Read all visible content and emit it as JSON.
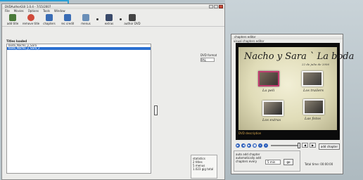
{
  "main_window": {
    "title": "DVDAuthorGUI 1.0.4 - 7/15/2007",
    "menu": [
      "File",
      "Movies",
      "Options",
      "Tools",
      "Window"
    ],
    "toolbar": [
      {
        "label": "add title",
        "icon": "add-title-icon",
        "color": "#4a7a3a"
      },
      {
        "label": "remove title",
        "icon": "remove-title-icon",
        "color": "#d04a3a"
      },
      {
        "label": "chapters",
        "icon": "chapters-icon",
        "color": "#3a6db5"
      },
      {
        "label": "rec credit",
        "icon": "rec-credit-icon",
        "color": "#3a6db5"
      },
      {
        "label": "menus",
        "icon": "menus-icon",
        "color": "#6a8fb8"
      },
      {
        "label": "extras",
        "icon": "extras-icon",
        "color": "#3a4a6a"
      },
      {
        "label": "author DVD",
        "icon": "author-dvd-icon",
        "color": "#444"
      }
    ],
    "list_label": "Titles loaded",
    "titles": [
      "boda_Nacho_y_Sara",
      "boda_Nacho_y_Sara_2"
    ],
    "selected_index": 1,
    "dvd_format_label": "DVD format",
    "dvd_format_value": "PAL",
    "stats": {
      "heading": "statistics",
      "lines": [
        "2 titles",
        "5 menus",
        "1.023 gig total"
      ]
    }
  },
  "chapters_window": {
    "title": "chapters editor",
    "preview_label": "visual chapters editor",
    "menu_title": "Nacho y Sara ` La boda",
    "menu_date": "22 de julio de 2006",
    "items": [
      "La peli",
      "Los trailers",
      "Los extras",
      "Las fotos"
    ],
    "dvd_desc": "DVD description",
    "add_chapter": "add chapter",
    "auto_add_label": "auto add chapter",
    "auto_every_label": "automatically add chapters every",
    "minutes_value": "5 min",
    "go_label": "go",
    "total_time": "Total time: 00:00:00"
  },
  "colors": {
    "accent": "#2a9fd6",
    "selection": "#2a6fd0"
  }
}
